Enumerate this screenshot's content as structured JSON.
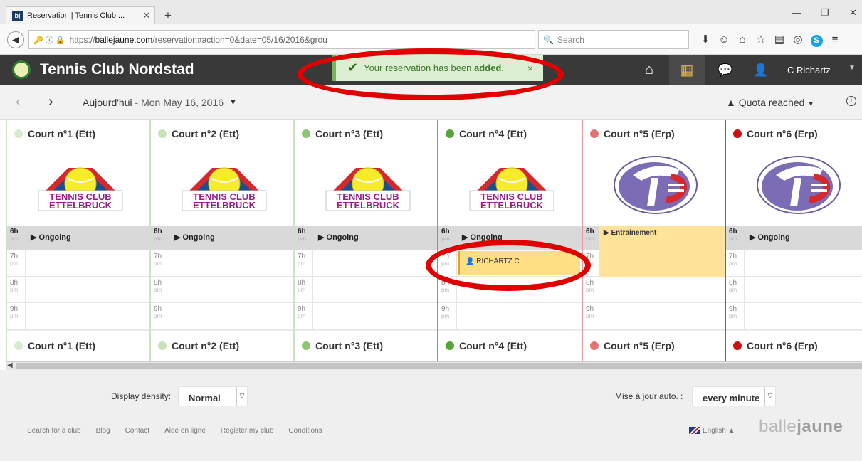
{
  "browser": {
    "tab_title": "Reservation | Tennis Club ...",
    "tab_favicon": "bj",
    "new_tab": "+",
    "url_scheme": "https://",
    "url_domain": "ballejaune.com",
    "url_rest": "/reservation#action=0&date=05/16/2016&grou",
    "search_placeholder": "Search"
  },
  "app": {
    "club_name": "Tennis Club Nordstad",
    "user_name": "C Richartz"
  },
  "toast": {
    "message_prefix": "Your reservation has been ",
    "message_bold": "added",
    "message_suffix": ".",
    "close": "×"
  },
  "datebar": {
    "today": "Aujourd'hui",
    "separator": " - ",
    "date": "Mon May 16, 2016",
    "quota": "Quota reached",
    "info": "i"
  },
  "courts": [
    {
      "name": "Court n°1 (Ett)",
      "status_color": "#d8ead0"
    },
    {
      "name": "Court n°2 (Ett)",
      "status_color": "#c7e2b8"
    },
    {
      "name": "Court n°3 (Ett)",
      "status_color": "#8fc472"
    },
    {
      "name": "Court n°4 (Ett)",
      "status_color": "#56a53b"
    },
    {
      "name": "Court n°5 (Erp)",
      "status_color": "#e27373"
    },
    {
      "name": "Court n°6 (Erp)",
      "status_color": "#cc1111"
    }
  ],
  "logos": {
    "ettelbruck_line1": "TENNIS CLUB",
    "ettelbruck_line2": "ETTELBRUCK"
  },
  "hours": [
    {
      "h": "6h",
      "p": "pm"
    },
    {
      "h": "7h",
      "p": "pm"
    },
    {
      "h": "8h",
      "p": "pm"
    },
    {
      "h": "9h",
      "p": "pm"
    }
  ],
  "events": {
    "ongoing": "Ongoing",
    "booking_name": "RICHARTZ C",
    "training": "Entraînement"
  },
  "footer": {
    "density_label": "Display density:",
    "density_value": "Normal",
    "auto_label": "Mise à jour auto. :",
    "auto_value": "every minute",
    "links": [
      "Search for a club",
      "Blog",
      "Contact",
      "Aide en ligne",
      "Register my club",
      "Conditions"
    ],
    "language": "English",
    "brand_a": "balle",
    "brand_b": "jaune"
  },
  "colors": {
    "header_bg": "#393939",
    "toast_bg": "#dcefd2",
    "booking_bg": "#ffde84",
    "annotation": "#e10000"
  }
}
